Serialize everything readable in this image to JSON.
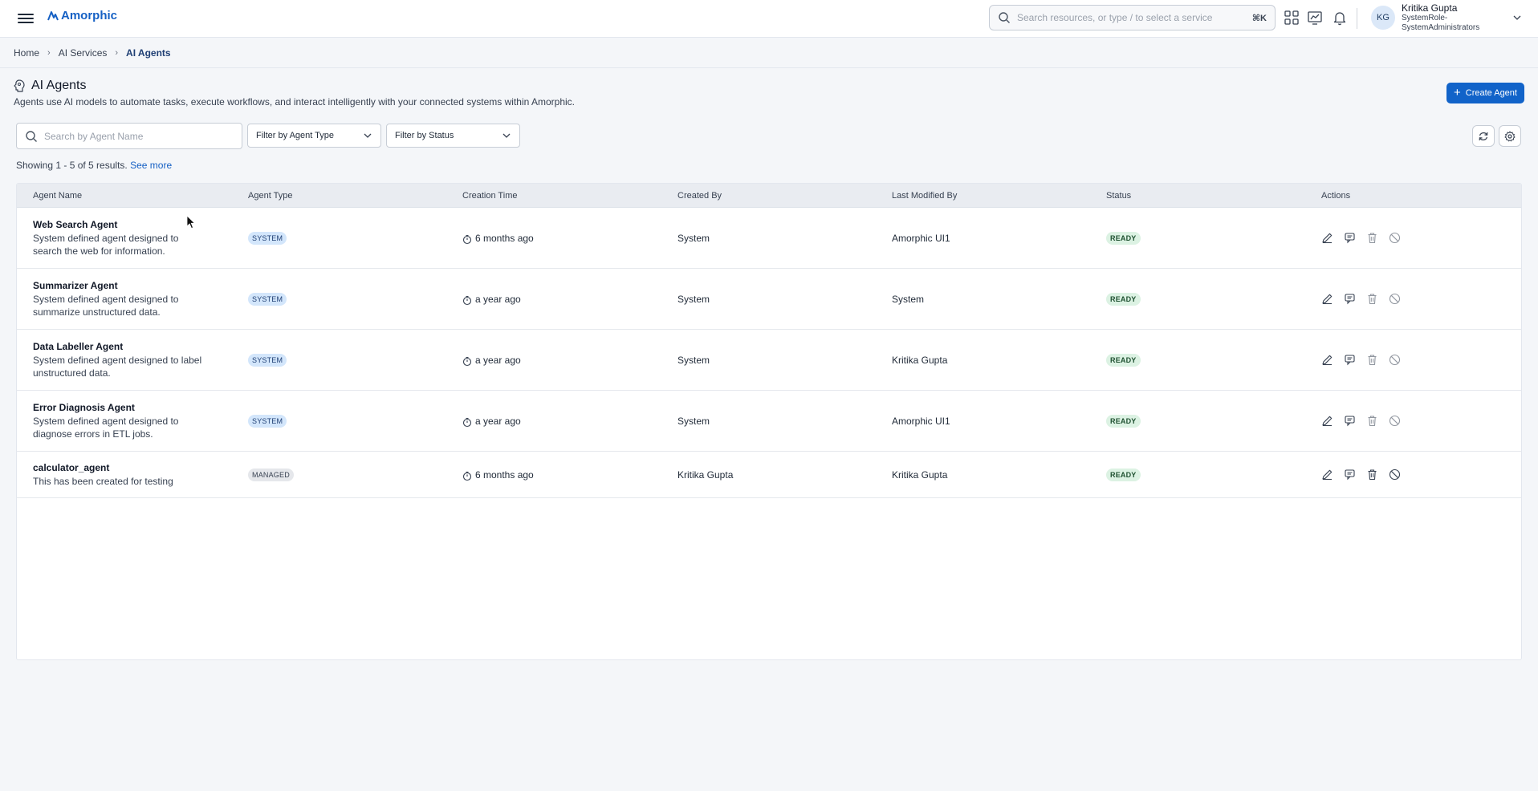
{
  "app": {
    "brand": "Amorphic",
    "search_placeholder": "Search resources, or type / to select a service",
    "search_shortcut": "⌘K",
    "user": {
      "initials": "KG",
      "name": "Kritika Gupta",
      "role": "SystemRole-SystemAdministrators"
    }
  },
  "breadcrumb": [
    "Home",
    "AI Services",
    "AI Agents"
  ],
  "page": {
    "title": "AI Agents",
    "description": "Agents use AI models to automate tasks, execute workflows, and interact intelligently with your connected systems within Amorphic.",
    "create_button": "Create Agent"
  },
  "filters": {
    "search_placeholder": "Search by Agent Name",
    "agent_type": "Filter by Agent Type",
    "status": "Filter by Status"
  },
  "results": {
    "text": "Showing 1 - 5 of 5 results.",
    "link": "See more"
  },
  "table": {
    "columns": [
      "Agent Name",
      "Agent Type",
      "Creation Time",
      "Created By",
      "Last Modified By",
      "Status",
      "Actions"
    ],
    "rows": [
      {
        "name": "Web Search Agent",
        "description": "System defined agent designed to search the web for information.",
        "type": "SYSTEM",
        "created": "6 months ago",
        "created_by": "System",
        "modified_by": "Amorphic UI1",
        "status": "READY"
      },
      {
        "name": "Summarizer Agent",
        "description": "System defined agent designed to summarize unstructured data.",
        "type": "SYSTEM",
        "created": "a year ago",
        "created_by": "System",
        "modified_by": "System",
        "status": "READY"
      },
      {
        "name": "Data Labeller Agent",
        "description": "System defined agent designed to label unstructured data.",
        "type": "SYSTEM",
        "created": "a year ago",
        "created_by": "System",
        "modified_by": "Kritika Gupta",
        "status": "READY"
      },
      {
        "name": "Error Diagnosis Agent",
        "description": "System defined agent designed to diagnose errors in ETL jobs.",
        "type": "SYSTEM",
        "created": "a year ago",
        "created_by": "System",
        "modified_by": "Amorphic UI1",
        "status": "READY"
      },
      {
        "name": "calculator_agent",
        "description": "This has been created for testing",
        "type": "MANAGED",
        "created": "6 months ago",
        "created_by": "Kritika Gupta",
        "modified_by": "Kritika Gupta",
        "status": "READY"
      }
    ]
  },
  "colors": {
    "primary": "#1163c9",
    "system_badge_bg": "#d3e6fb",
    "ready_badge_bg": "#dcf2e3"
  },
  "icons": [
    "menu-icon",
    "logo-icon",
    "search-icon",
    "apps-grid-icon",
    "analytics-icon",
    "bell-icon",
    "chevron-down-icon",
    "agent-icon",
    "refresh-icon",
    "settings-icon",
    "clock-icon",
    "edit-icon",
    "chat-icon",
    "trash-icon",
    "disable-icon"
  ]
}
